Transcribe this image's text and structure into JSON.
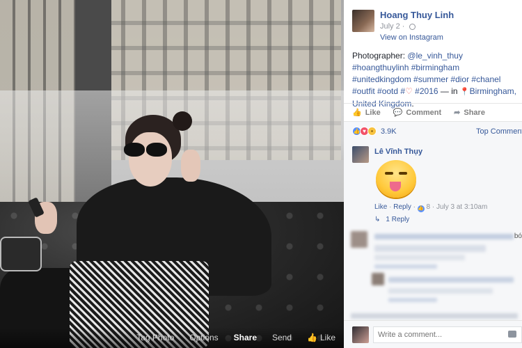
{
  "photo": {
    "toolbar": {
      "tag_photo": "Tag Photo",
      "options": "Options",
      "share": "Share",
      "send": "Send",
      "like": "Like"
    }
  },
  "post": {
    "author": "Hoang Thuy Linh",
    "date": "July 2 ·",
    "via": "View on Instagram",
    "caption": {
      "prefix": "Photographer: ",
      "photographer": "@le_vinh_thuy",
      "tags_line": "#hoangthuylinh #birmingham #unitedkingdom #summer #dior #chanel #outfit #ootd #",
      "year_tag": "#2016",
      "in_text": " — in ",
      "location": "Birmingham, United Kingdom",
      "end": "."
    },
    "actions": {
      "like": "Like",
      "comment": "Comment",
      "share": "Share"
    },
    "reactions": {
      "count": "3.9K",
      "sort_label": "Top Comments"
    }
  },
  "comment": {
    "author": "Lê Vĩnh Thụy",
    "like_link": "Like",
    "reply_link": "Reply",
    "like_count": "8",
    "timestamp": "July 3 at 3:10am",
    "replies_link": "1 Reply",
    "cut_text": "bó"
  },
  "composer": {
    "placeholder": "Write a comment..."
  },
  "colors": {
    "link": "#365899",
    "like_blue": "#5890ff",
    "love_red": "#f25268",
    "wow_yellow": "#f7c23f"
  }
}
